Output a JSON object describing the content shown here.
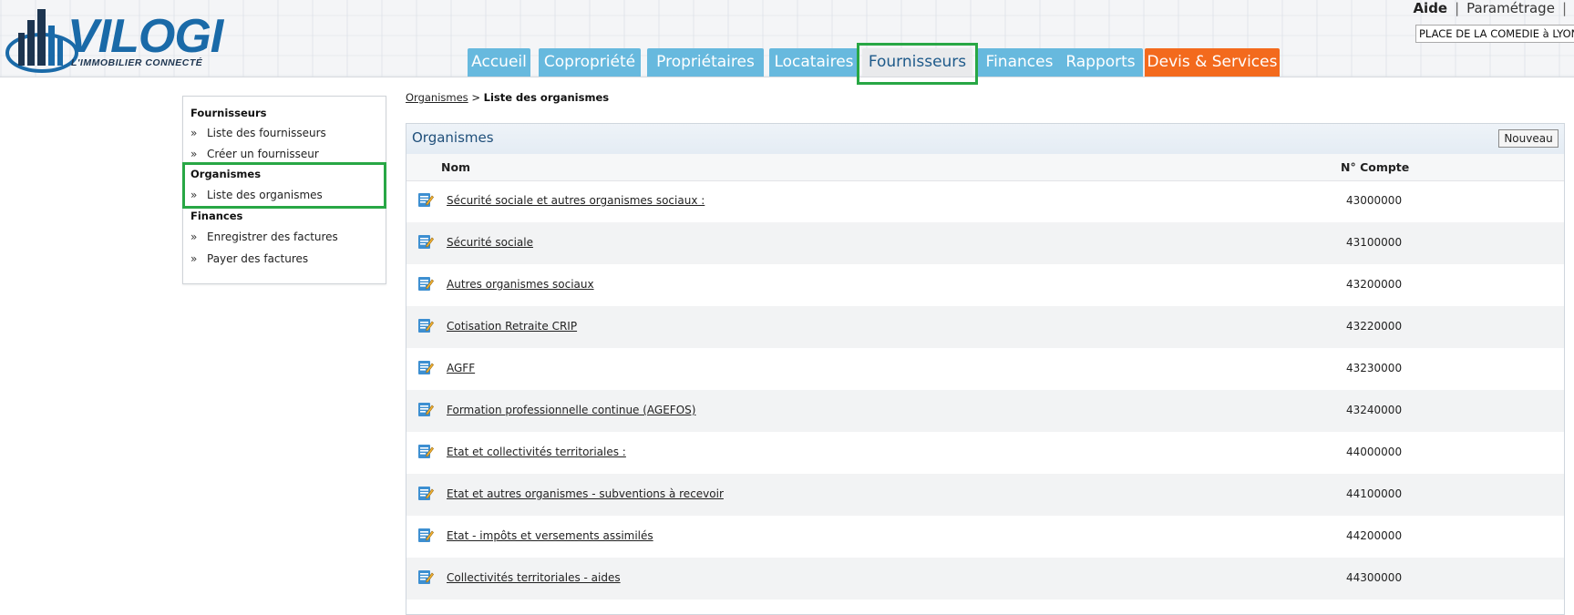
{
  "logo": {
    "name": "VILOGI",
    "tagline": "L'IMMOBILIER CONNECTÉ",
    "color": "#1a6aa8"
  },
  "top_links": {
    "aide": "Aide",
    "parametrage": "Paramétrage",
    "separator": "|"
  },
  "site_select": {
    "value": "PLACE DE LA COMEDIE à LYON"
  },
  "tabs": [
    {
      "label": "Accueil",
      "state": "normal"
    },
    {
      "label": "Copropriété",
      "state": "normal"
    },
    {
      "label": "Propriétaires",
      "state": "normal"
    },
    {
      "label": "Locataires",
      "state": "normal"
    },
    {
      "label": "Fournisseurs",
      "state": "active"
    },
    {
      "label": "Finances",
      "state": "normal"
    },
    {
      "label": "Rapports",
      "state": "normal"
    },
    {
      "label": "Devis & Services",
      "state": "orange"
    }
  ],
  "sidebar": {
    "sections": [
      {
        "title": "Fournisseurs",
        "items": [
          "Liste des fournisseurs",
          "Créer un fournisseur"
        ]
      },
      {
        "title": "Organismes",
        "items": [
          "Liste des organismes"
        ]
      },
      {
        "title": "Finances",
        "items": [
          "Enregistrer des factures",
          "Payer des factures"
        ]
      }
    ],
    "arrow": "»"
  },
  "breadcrumb": {
    "link": "Organismes",
    "separator": ">",
    "current": "Liste des organismes"
  },
  "panel": {
    "title": "Organismes",
    "new_button": "Nouveau",
    "columns": {
      "nom": "Nom",
      "compte": "N° Compte"
    },
    "rows": [
      {
        "name": "Sécurité sociale et autres organismes sociaux :",
        "account": "43000000"
      },
      {
        "name": "Sécurité sociale",
        "account": "43100000"
      },
      {
        "name": "Autres organismes sociaux",
        "account": "43200000"
      },
      {
        "name": "Cotisation Retraite CRIP",
        "account": "43220000"
      },
      {
        "name": "AGFF",
        "account": "43230000"
      },
      {
        "name": "Formation professionnelle continue (AGEFOS)",
        "account": "43240000"
      },
      {
        "name": "Etat et collectivités territoriales :",
        "account": "44000000"
      },
      {
        "name": "Etat et autres organismes - subventions à recevoir",
        "account": "44100000"
      },
      {
        "name": "Etat - impôts et versements assimilés",
        "account": "44200000"
      },
      {
        "name": "Collectivités territoriales - aides",
        "account": "44300000"
      }
    ]
  },
  "colors": {
    "tab_blue": "#67b9de",
    "tab_orange": "#f36a1d",
    "highlight_green": "#28a745",
    "title_blue": "#1f4f7a"
  },
  "icons": {
    "row_icon": "edit-note-icon",
    "logo_icon": "building-logo-icon"
  }
}
